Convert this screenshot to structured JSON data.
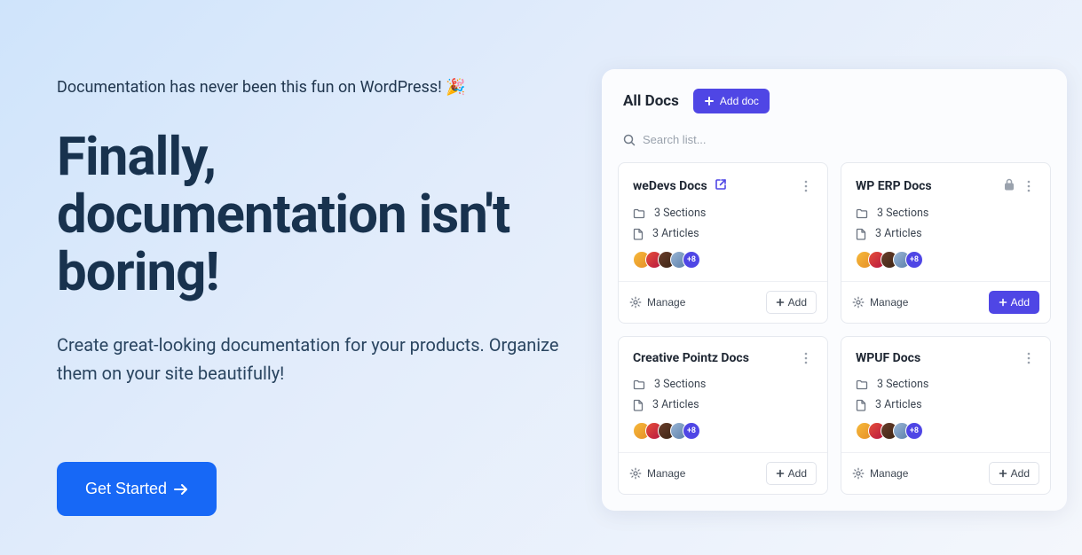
{
  "hero": {
    "eyebrow": "Documentation has never been this fun on WordPress! 🎉",
    "headline": "Finally, documentation isn't boring!",
    "subcopy": "Create great-looking documentation for your products. Organize them on your site beautifully!",
    "cta_label": "Get Started"
  },
  "panel": {
    "title": "All Docs",
    "add_doc_label": "Add doc",
    "search_placeholder": "Search list...",
    "manage_label": "Manage",
    "add_label": "Add",
    "avatar_overflow": "+8",
    "cards": [
      {
        "title": "weDevs Docs",
        "sections": "3 Sections",
        "articles": "3 Articles",
        "link": true,
        "locked": false,
        "primary_add": false
      },
      {
        "title": "WP ERP Docs",
        "sections": "3 Sections",
        "articles": "3 Articles",
        "link": false,
        "locked": true,
        "primary_add": true
      },
      {
        "title": "Creative Pointz Docs",
        "sections": "3 Sections",
        "articles": "3 Articles",
        "link": false,
        "locked": false,
        "primary_add": false
      },
      {
        "title": "WPUF Docs",
        "sections": "3 Sections",
        "articles": "3 Articles",
        "link": false,
        "locked": false,
        "primary_add": false
      }
    ]
  }
}
